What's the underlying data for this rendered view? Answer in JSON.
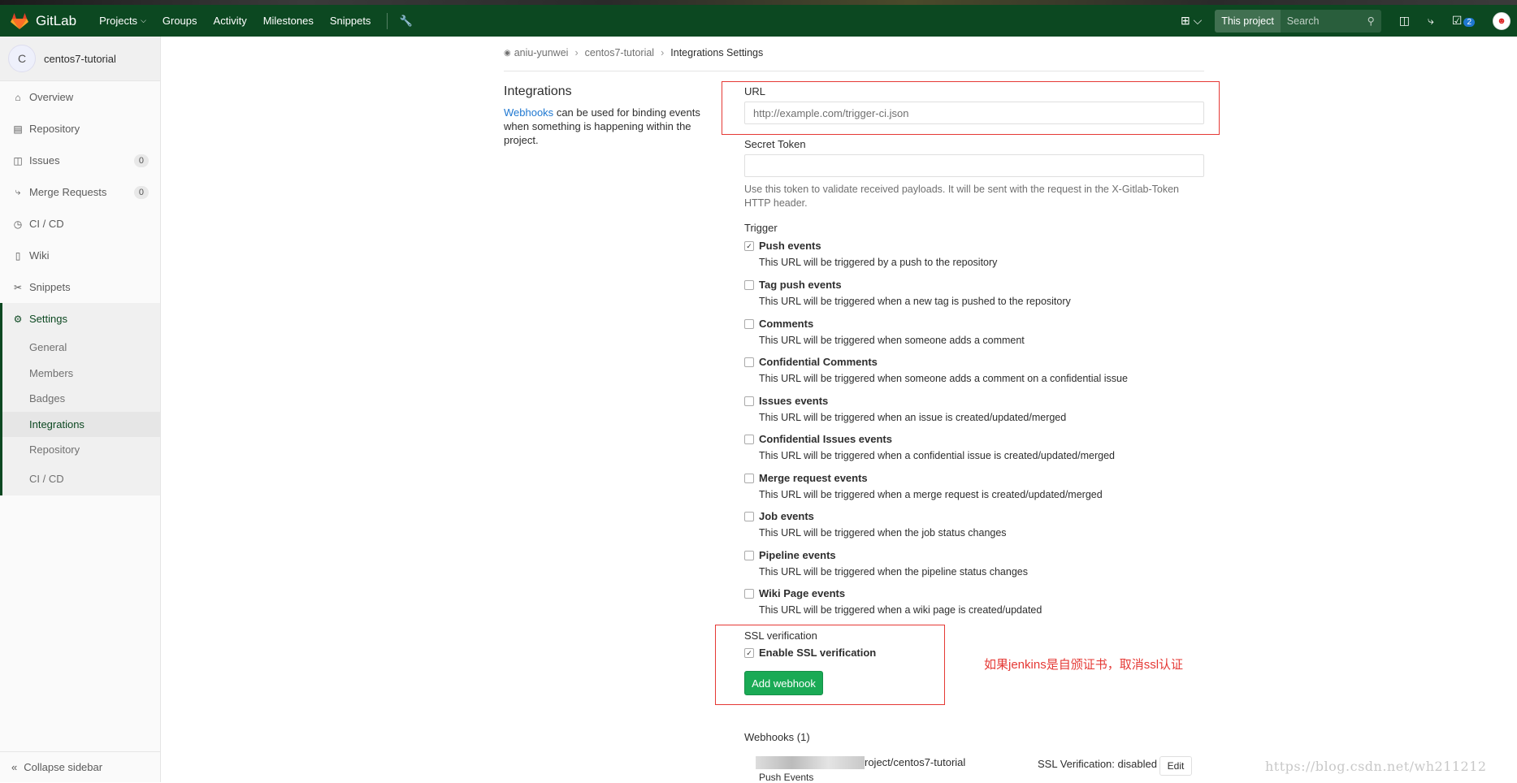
{
  "navbar": {
    "brand": "GitLab",
    "links": [
      "Projects",
      "Groups",
      "Activity",
      "Milestones",
      "Snippets"
    ],
    "scope": "This project",
    "search_placeholder": "Search",
    "todo_count": "2",
    "icons": [
      "gitlab-logo-icon",
      "chevron-down-icon",
      "wrench-icon",
      "plus-square-icon",
      "issues-icon",
      "merge-request-icon",
      "todo-icon",
      "search-icon",
      "user-avatar-icon"
    ]
  },
  "sidebar": {
    "project_initial": "C",
    "project_name": "centos7-tutorial",
    "items": [
      {
        "label": "Overview",
        "icon": "home-icon"
      },
      {
        "label": "Repository",
        "icon": "book-icon"
      },
      {
        "label": "Issues",
        "icon": "issues-icon",
        "count": "0"
      },
      {
        "label": "Merge Requests",
        "icon": "merge-request-icon",
        "count": "0"
      },
      {
        "label": "CI / CD",
        "icon": "rocket-icon"
      },
      {
        "label": "Wiki",
        "icon": "wiki-icon"
      },
      {
        "label": "Snippets",
        "icon": "scissors-icon"
      }
    ],
    "settings": {
      "label": "Settings",
      "sub": [
        "General",
        "Members",
        "Badges",
        "Integrations",
        "Repository",
        "CI / CD"
      ],
      "active": "Integrations"
    },
    "collapse": "Collapse sidebar"
  },
  "breadcrumb": {
    "owner": "aniu-yunwei",
    "project": "centos7-tutorial",
    "current": "Integrations Settings"
  },
  "intro": {
    "title": "Integrations",
    "link": "Webhooks",
    "text": "can be used for binding events when something is happening within the project."
  },
  "form": {
    "url_label": "URL",
    "url_placeholder": "http://example.com/trigger-ci.json",
    "token_label": "Secret Token",
    "token_help": "Use this token to validate received payloads. It will be sent with the request in the X-Gitlab-Token HTTP header.",
    "trigger_label": "Trigger",
    "triggers": [
      {
        "title": "Push events",
        "desc": "This URL will be triggered by a push to the repository",
        "checked": true
      },
      {
        "title": "Tag push events",
        "desc": "This URL will be triggered when a new tag is pushed to the repository",
        "checked": false
      },
      {
        "title": "Comments",
        "desc": "This URL will be triggered when someone adds a comment",
        "checked": false
      },
      {
        "title": "Confidential Comments",
        "desc": "This URL will be triggered when someone adds a comment on a confidential issue",
        "checked": false
      },
      {
        "title": "Issues events",
        "desc": "This URL will be triggered when an issue is created/updated/merged",
        "checked": false
      },
      {
        "title": "Confidential Issues events",
        "desc": "This URL will be triggered when a confidential issue is created/updated/merged",
        "checked": false
      },
      {
        "title": "Merge request events",
        "desc": "This URL will be triggered when a merge request is created/updated/merged",
        "checked": false
      },
      {
        "title": "Job events",
        "desc": "This URL will be triggered when the job status changes",
        "checked": false
      },
      {
        "title": "Pipeline events",
        "desc": "This URL will be triggered when the pipeline status changes",
        "checked": false
      },
      {
        "title": "Wiki Page events",
        "desc": "This URL will be triggered when a wiki page is created/updated",
        "checked": false
      }
    ],
    "ssl_label": "SSL verification",
    "ssl_option": "Enable SSL verification",
    "ssl_checked": true,
    "submit": "Add webhook"
  },
  "annotation": "如果jenkins是自颁证书，取消ssl认证",
  "webhooks": {
    "title": "Webhooks (1)",
    "url_tail": "roject/centos7-tutorial",
    "events": "Push Events",
    "ssl_status": "SSL Verification: disabled",
    "edit": "Edit"
  },
  "watermark": "https://blog.csdn.net/wh211212",
  "colors": {
    "navbar": "#0c4821",
    "accent_link": "#1f78d1",
    "primary_button": "#1aaa55",
    "annotation": "#e53935"
  }
}
